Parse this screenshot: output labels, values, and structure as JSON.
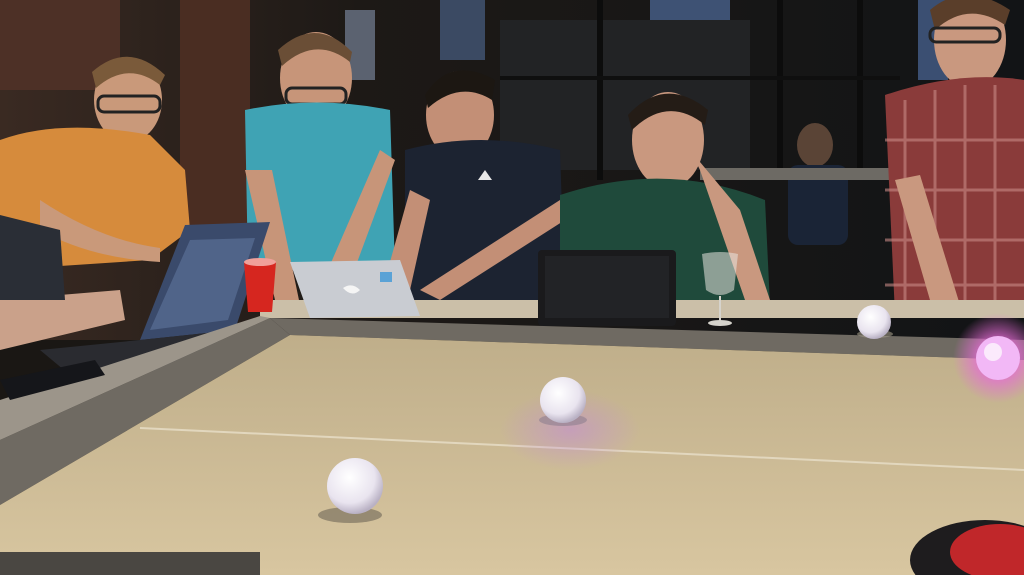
{
  "photo": {
    "subjects": [
      {
        "id": "person-orange-shirt"
      },
      {
        "id": "person-teal-shirt"
      },
      {
        "id": "person-navy-shirt"
      },
      {
        "id": "person-green-shirt"
      },
      {
        "id": "person-plaid-shirt"
      },
      {
        "id": "person-background"
      }
    ],
    "objects": [
      {
        "id": "laptop-patterned"
      },
      {
        "id": "laptop-silver"
      },
      {
        "id": "laptop-black"
      },
      {
        "id": "red-cup"
      },
      {
        "id": "wine-glass"
      },
      {
        "id": "sphero-ball-center"
      },
      {
        "id": "sphero-ball-front"
      },
      {
        "id": "sphero-ball-back"
      },
      {
        "id": "sphero-ball-pink-glow"
      }
    ],
    "colors": {
      "table_surface": "#cdb993",
      "table_rail": "#6f6a62",
      "wall_dark": "#1b1815",
      "orange_shirt": "#d68b3c",
      "teal_shirt": "#3fa3b4",
      "navy_shirt": "#1c2331",
      "green_shirt": "#1f4a3b",
      "plaid_shirt": "#8a3b3a",
      "ball_white": "#f3f0f6",
      "glow_pink": "#e66bd6",
      "red_cup": "#d6261f"
    }
  }
}
